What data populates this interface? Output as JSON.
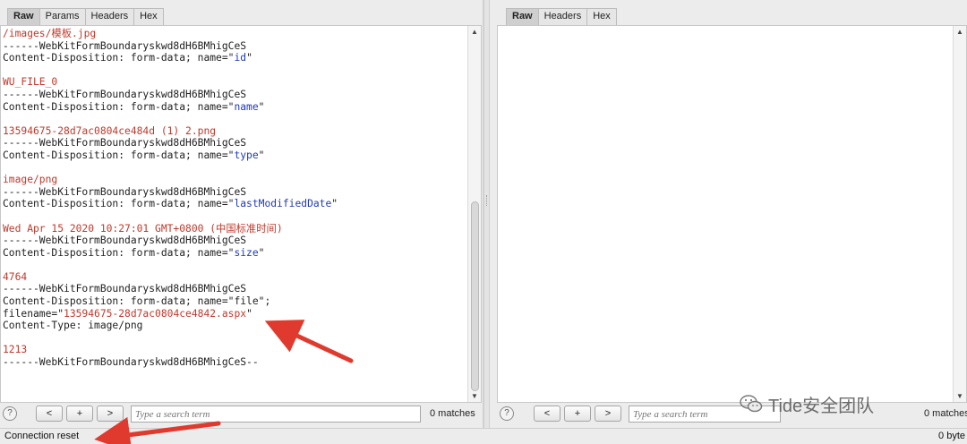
{
  "left_pane": {
    "tabs": [
      "Raw",
      "Params",
      "Headers",
      "Hex"
    ],
    "active_tab": "Raw",
    "body_lines": [
      [
        {
          "t": "/images/模板.jpg",
          "c": "r"
        }
      ],
      [
        {
          "t": "------WebKitFormBoundaryskwd8dH6BMhigCeS",
          "c": ""
        }
      ],
      [
        {
          "t": "Content-Disposition: form-data; name=\"",
          "c": ""
        },
        {
          "t": "id",
          "c": "b"
        },
        {
          "t": "\"",
          "c": ""
        }
      ],
      [
        {
          "t": "",
          "c": ""
        }
      ],
      [
        {
          "t": "WU_FILE_0",
          "c": "r"
        }
      ],
      [
        {
          "t": "------WebKitFormBoundaryskwd8dH6BMhigCeS",
          "c": ""
        }
      ],
      [
        {
          "t": "Content-Disposition: form-data; name=\"",
          "c": ""
        },
        {
          "t": "name",
          "c": "b"
        },
        {
          "t": "\"",
          "c": ""
        }
      ],
      [
        {
          "t": "",
          "c": ""
        }
      ],
      [
        {
          "t": "13594675-28d7ac0804ce484d (1) 2.png",
          "c": "r"
        }
      ],
      [
        {
          "t": "------WebKitFormBoundaryskwd8dH6BMhigCeS",
          "c": ""
        }
      ],
      [
        {
          "t": "Content-Disposition: form-data; name=\"",
          "c": ""
        },
        {
          "t": "type",
          "c": "b"
        },
        {
          "t": "\"",
          "c": ""
        }
      ],
      [
        {
          "t": "",
          "c": ""
        }
      ],
      [
        {
          "t": "image/png",
          "c": "r"
        }
      ],
      [
        {
          "t": "------WebKitFormBoundaryskwd8dH6BMhigCeS",
          "c": ""
        }
      ],
      [
        {
          "t": "Content-Disposition: form-data; name=\"",
          "c": ""
        },
        {
          "t": "lastModifiedDate",
          "c": "b"
        },
        {
          "t": "\"",
          "c": ""
        }
      ],
      [
        {
          "t": "",
          "c": ""
        }
      ],
      [
        {
          "t": "Wed Apr 15 2020 10:27:01 GMT+0800 (中国标准时间)",
          "c": "r"
        }
      ],
      [
        {
          "t": "------WebKitFormBoundaryskwd8dH6BMhigCeS",
          "c": ""
        }
      ],
      [
        {
          "t": "Content-Disposition: form-data; name=\"",
          "c": ""
        },
        {
          "t": "size",
          "c": "b"
        },
        {
          "t": "\"",
          "c": ""
        }
      ],
      [
        {
          "t": "",
          "c": ""
        }
      ],
      [
        {
          "t": "4764",
          "c": "r"
        }
      ],
      [
        {
          "t": "------WebKitFormBoundaryskwd8dH6BMhigCeS",
          "c": ""
        }
      ],
      [
        {
          "t": "Content-Disposition: form-data; name=\"file\";",
          "c": ""
        }
      ],
      [
        {
          "t": "filename=\"",
          "c": ""
        },
        {
          "t": "13594675-28d7ac0804ce4842.aspx",
          "c": "r"
        },
        {
          "t": "\"",
          "c": ""
        }
      ],
      [
        {
          "t": "Content-Type: image/png",
          "c": ""
        }
      ],
      [
        {
          "t": "",
          "c": ""
        }
      ],
      [
        {
          "t": "1213",
          "c": "r"
        }
      ],
      [
        {
          "t": "------WebKitFormBoundaryskwd8dH6BMhigCeS--",
          "c": ""
        }
      ]
    ],
    "search": {
      "help": "?",
      "prev": "<",
      "add": "+",
      "next": ">",
      "placeholder": "Type a search term",
      "matches": "0 matches"
    }
  },
  "right_pane": {
    "tabs": [
      "Raw",
      "Headers",
      "Hex"
    ],
    "active_tab": "Raw",
    "search": {
      "help": "?",
      "prev": "<",
      "add": "+",
      "next": ">",
      "placeholder": "Type a search term",
      "matches": "0 matches"
    }
  },
  "status_bar": {
    "left": "Connection reset",
    "right": "0 byte"
  },
  "watermark": {
    "text": "Tide安全团队",
    "icon": "wechat-icon"
  },
  "colors": {
    "annotation_arrow": "#e03a2e",
    "value_text": "#c0392b",
    "field_name_text": "#1f3bb5"
  }
}
